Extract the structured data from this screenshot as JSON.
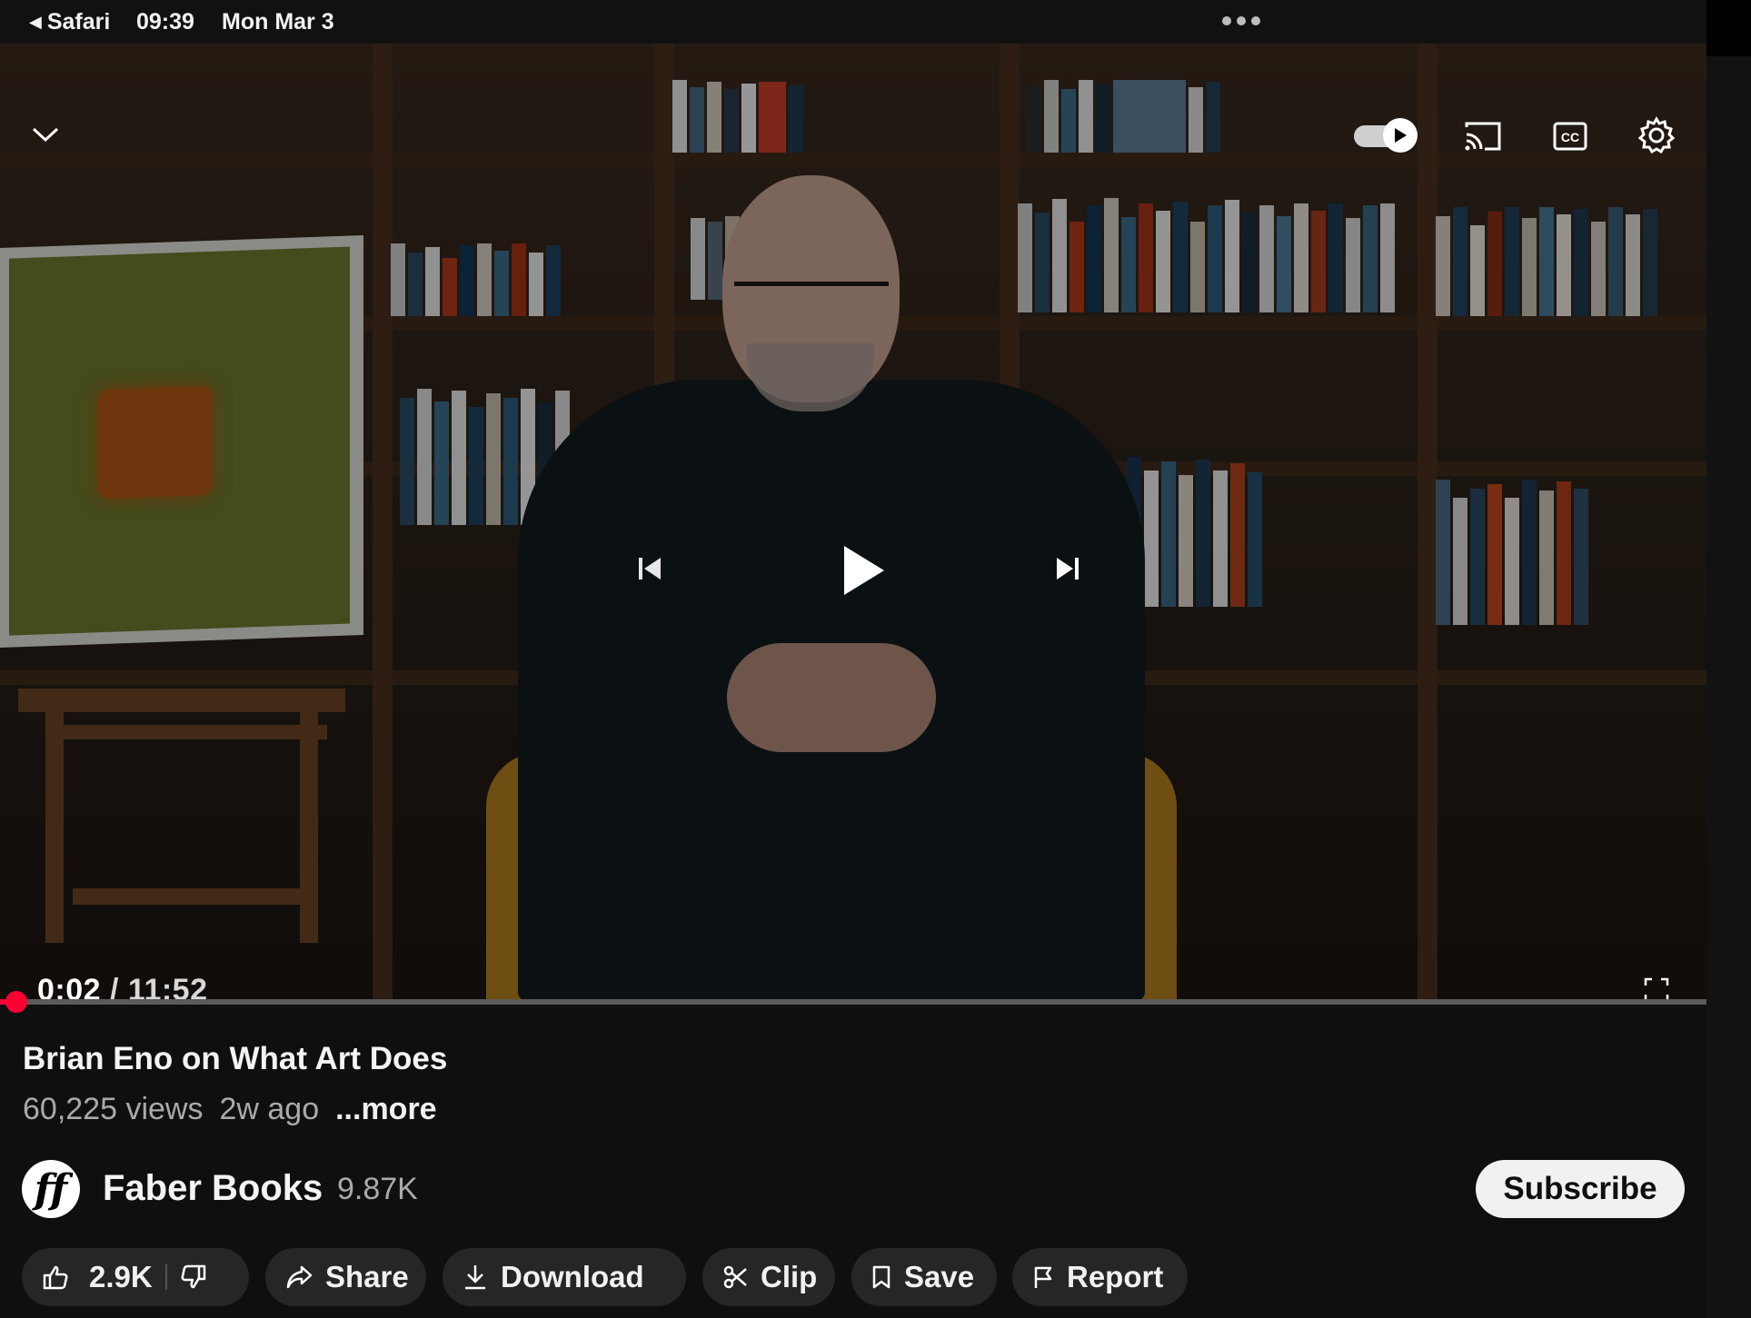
{
  "statusbar": {
    "back_label": "Safari",
    "time": "09:39",
    "date": "Mon Mar 3"
  },
  "player": {
    "current_time": "0:02",
    "separator": " / ",
    "duration": "11:52",
    "progress_fraction": 0.003,
    "autoplay_on": true,
    "accent": "#ff0033"
  },
  "video": {
    "title": "Brian Eno on What Art Does",
    "views": "60,225 views",
    "age": "2w ago",
    "more_label": "...more"
  },
  "channel": {
    "avatar_text": "ff",
    "name": "Faber Books",
    "subscribers": "9.87K",
    "subscribe_label": "Subscribe"
  },
  "actions": {
    "likes": "2.9K",
    "share": "Share",
    "download": "Download",
    "clip": "Clip",
    "save": "Save",
    "report": "Report"
  },
  "icons": {
    "statusbar": [
      "back-arrow-icon",
      "more-dots-icon"
    ],
    "player": [
      "chevron-down-icon",
      "autoplay-toggle-icon",
      "cast-icon",
      "cc-icon",
      "settings-gear-icon",
      "previous-icon",
      "play-icon",
      "next-icon",
      "fullscreen-icon"
    ],
    "actions": [
      "thumbs-up-icon",
      "thumbs-down-icon",
      "share-arrow-icon",
      "download-icon",
      "scissors-icon",
      "bookmark-icon",
      "flag-icon"
    ]
  }
}
